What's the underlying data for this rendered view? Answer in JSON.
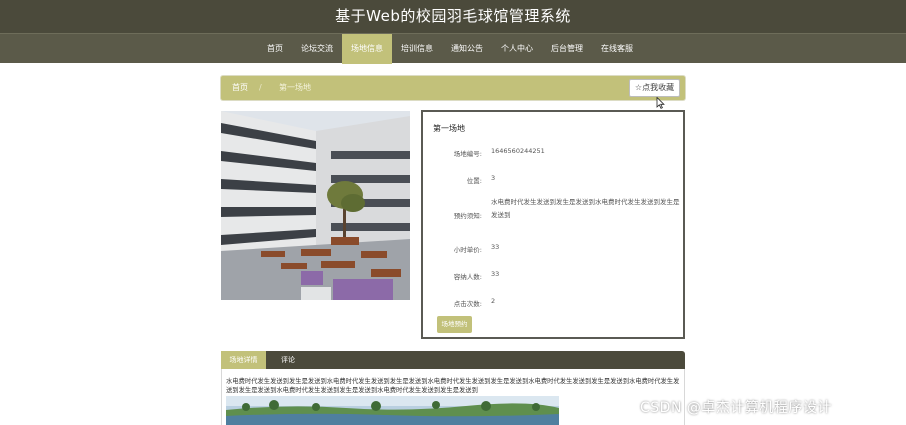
{
  "header": {
    "site_title": "基于Web的校园羽毛球馆管理系统"
  },
  "nav": {
    "items": [
      {
        "label": "首页",
        "active": false
      },
      {
        "label": "论坛交流",
        "active": false
      },
      {
        "label": "场地信息",
        "active": true
      },
      {
        "label": "培训信息",
        "active": false
      },
      {
        "label": "通知公告",
        "active": false
      },
      {
        "label": "个人中心",
        "active": false
      },
      {
        "label": "后台管理",
        "active": false
      },
      {
        "label": "在线客服",
        "active": false
      }
    ]
  },
  "breadcrumb": {
    "home": "首页",
    "current": "第一场地"
  },
  "favorite_button": {
    "icon": "star-outline-icon",
    "label": "☆点我收藏"
  },
  "venue": {
    "name": "第一场地",
    "rows": [
      {
        "label": "场地编号:",
        "value": "1646560244251"
      },
      {
        "label": "位置:",
        "value": "3"
      },
      {
        "label": "预约须知:",
        "value": "水电费时代发生发送到发生是发送到水电费时代发生发送到发生是发送到"
      },
      {
        "label": "小时单价:",
        "value": "33"
      },
      {
        "label": "容纳人数:",
        "value": "33"
      },
      {
        "label": "点击次数:",
        "value": "2"
      }
    ],
    "book_button": "场地预约"
  },
  "tabs": [
    {
      "label": "场地详情",
      "active": true
    },
    {
      "label": "评论",
      "active": false
    }
  ],
  "detail_text": "水电费时代发生发送到发生是发送到水电费时代发生发送到发生是发送到水电费时代发生发送到发生是发送到水电费时代发生发送到发生是发送到水电费时代发生发送到发生是发送到水电费时代发生发送到发生是发送到水电费时代发生发送到发生是发送到",
  "watermark": "CSDN @卓杰计算机程序设计",
  "colors": {
    "header": "#4b4a3b",
    "nav": "#5b5a49",
    "accent": "#c2c17a"
  }
}
